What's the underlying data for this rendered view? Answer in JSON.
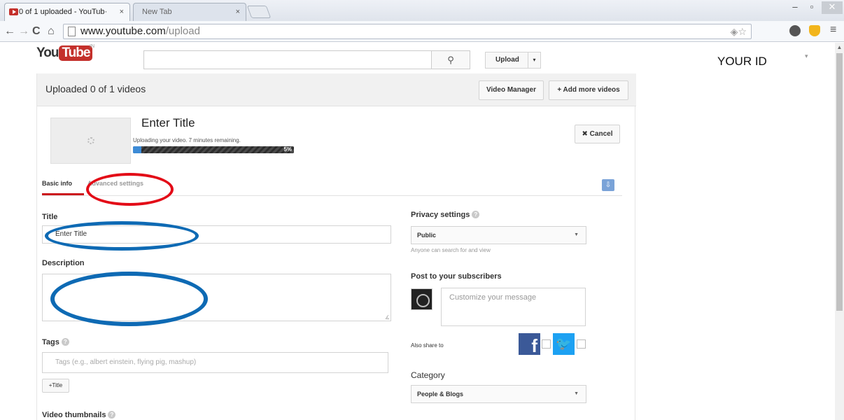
{
  "browser": {
    "tabs": [
      {
        "label": "0 of 1 uploaded - YouTub·",
        "close": "×"
      },
      {
        "label": "New Tab",
        "close": "×"
      }
    ],
    "window_controls": {
      "minimize": "–",
      "maximize": "▫",
      "close": "✕"
    },
    "nav": {
      "back": "←",
      "forward": "→",
      "reload": "C",
      "home": "⌂"
    },
    "url": {
      "host": "www.youtube.com",
      "path": "/upload"
    },
    "omnibox_icons": "◈☆",
    "menu": "≡"
  },
  "yt_header": {
    "logo_you": "You",
    "logo_tube": "Tube",
    "logo_region": "IN",
    "search_placeholder": "",
    "search_icon": "search-icon",
    "upload_label": "Upload",
    "upload_caret": "▾",
    "user_id": "YOUR ID",
    "user_caret": "▾"
  },
  "upload_panel": {
    "count_text": "Uploaded 0 of 1 videos",
    "video_manager": "Video Manager",
    "add_more": "+ Add more videos",
    "video_title": "Enter Title",
    "status_text": "Uploading your video. 7 minutes remaining.",
    "progress_percent": 5,
    "progress_label": "5%",
    "cancel": "✖ Cancel",
    "tabs": {
      "basic": "Basic info",
      "advanced": "Advanced settings"
    },
    "form": {
      "title_label": "Title",
      "title_value": "Enter Title",
      "description_label": "Description",
      "description_value": "",
      "tags_label": "Tags",
      "tags_placeholder": "Tags (e.g., albert einstein, flying pig, mashup)",
      "plus_title": "+Title",
      "thumbnails_label": "Video thumbnails"
    },
    "privacy": {
      "label": "Privacy settings",
      "value": "Public",
      "help": "Anyone can search for and view"
    },
    "subscribers": {
      "label": "Post to your subscribers",
      "message_placeholder": "Customize your message",
      "share_label": "Also share to",
      "facebook_glyph": "f",
      "twitter_glyph": "🐦"
    },
    "category": {
      "label": "Category",
      "value": "People & Blogs"
    }
  },
  "colors": {
    "youtube_red": "#c4302b",
    "progress_blue": "#3d8bd6",
    "annotation_red": "#e30b17",
    "annotation_blue": "#0e6ab4"
  }
}
